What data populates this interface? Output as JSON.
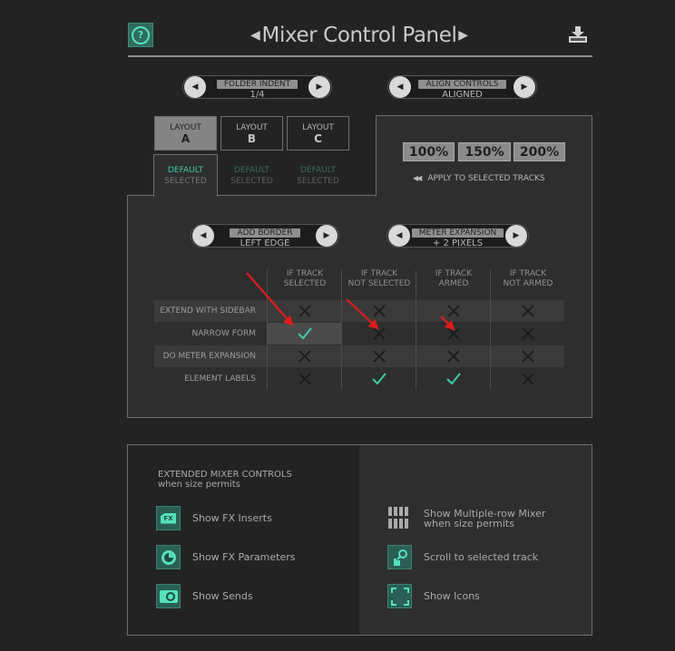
{
  "header": {
    "title": "Mixer Control Panel",
    "help_icon": "question-icon",
    "download_icon": "download-icon"
  },
  "folder_indent": {
    "label": "FOLDER INDENT",
    "value": "1/4"
  },
  "align_controls": {
    "label": "ALIGN CONTROLS",
    "value": "ALIGNED"
  },
  "layouts": [
    {
      "label": "LAYOUT",
      "letter": "A",
      "sub1": "DEFAULT",
      "sub2": "SELECTED",
      "active": true
    },
    {
      "label": "LAYOUT",
      "letter": "B",
      "sub1": "DEFAULT",
      "sub2": "SELECTED",
      "active": false
    },
    {
      "label": "LAYOUT",
      "letter": "C",
      "sub1": "DEFAULT",
      "sub2": "SELECTED",
      "active": false
    }
  ],
  "scale_buttons": [
    "100%",
    "150%",
    "200%"
  ],
  "apply_label": "APPLY TO SELECTED TRACKS",
  "add_border": {
    "label": "ADD BORDER",
    "value": "LEFT EDGE"
  },
  "meter_expansion": {
    "label": "METER EXPANSION",
    "value": "+ 2 PIXELS"
  },
  "grid": {
    "columns": [
      {
        "line1": "IF TRACK",
        "line2": "SELECTED"
      },
      {
        "line1": "IF TRACK",
        "line2": "NOT SELECTED"
      },
      {
        "line1": "IF TRACK",
        "line2": "ARMED"
      },
      {
        "line1": "IF TRACK",
        "line2": "NOT ARMED"
      }
    ],
    "rows": [
      {
        "label": "EXTEND WITH SIDEBAR",
        "values": [
          false,
          false,
          false,
          false
        ]
      },
      {
        "label": "NARROW FORM",
        "values": [
          true,
          false,
          false,
          false
        ]
      },
      {
        "label": "DO METER EXPANSION",
        "values": [
          false,
          false,
          false,
          false
        ]
      },
      {
        "label": "ELEMENT LABELS",
        "values": [
          false,
          true,
          true,
          false
        ]
      }
    ]
  },
  "extended": {
    "title_line1": "EXTENDED MIXER CONTROLS",
    "title_line2": "when size permits",
    "fx_icon_text": "FX",
    "left_options": [
      {
        "label": "Show FX Inserts",
        "icon": "fx-inserts-icon"
      },
      {
        "label": "Show FX Parameters",
        "icon": "fx-parameters-icon"
      },
      {
        "label": "Show Sends",
        "icon": "sends-icon"
      }
    ],
    "right_options": [
      {
        "label_line1": "Show Multiple-row Mixer",
        "label_line2": "when size permits",
        "icon": "multi-row-icon"
      },
      {
        "label": "Scroll to selected track",
        "icon": "scroll-to-track-icon"
      },
      {
        "label": "Show Icons",
        "icon": "show-icons-icon"
      }
    ]
  },
  "colors": {
    "accent": "#3fcaa6",
    "annotation_arrow": "#e01b1b",
    "background": "#232323",
    "panel": "#2e2e2e"
  }
}
